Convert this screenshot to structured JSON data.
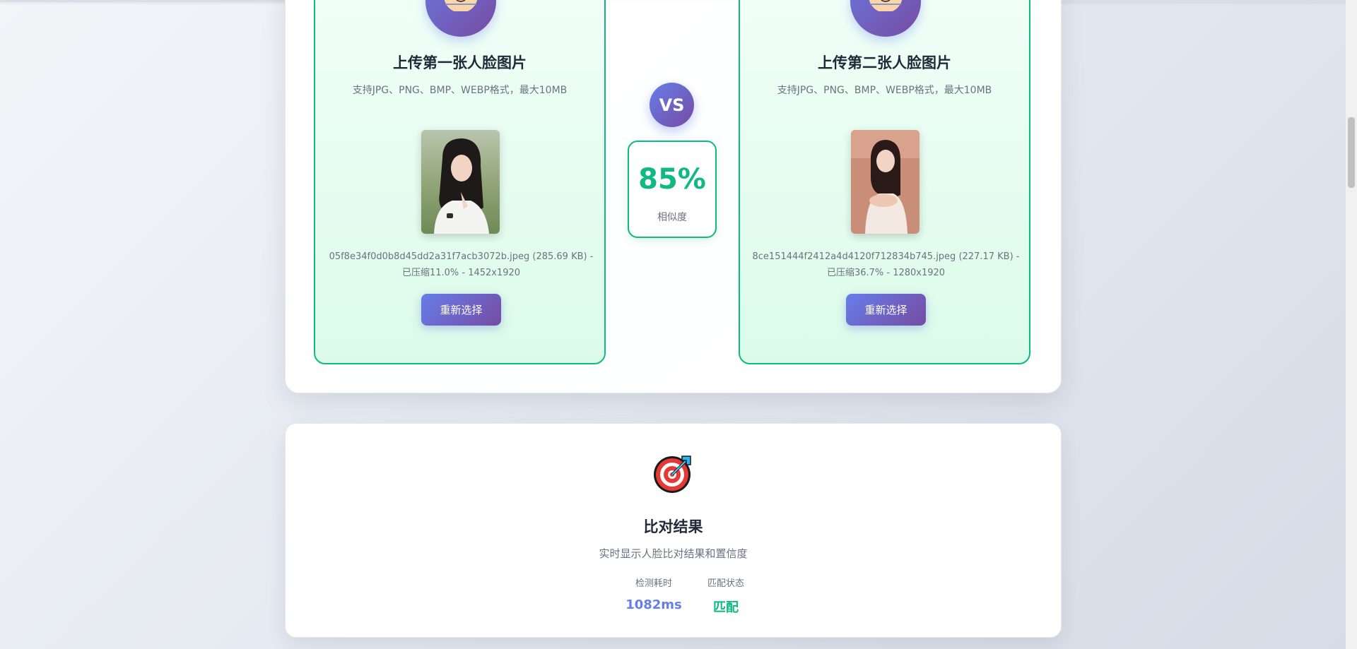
{
  "colors": {
    "accent": "#667eea",
    "accent_dark": "#764ba2",
    "success": "#10b981",
    "text_muted": "#6b7280"
  },
  "compare": {
    "left": {
      "title": "上传第一张人脸图片",
      "subtitle": "支持JPG、PNG、BMP、WEBP格式，最大10MB",
      "file_line1": "05f8e34f0d0b8d45dd2a31f7acb3072b.jpeg (285.69 KB) -",
      "file_line2": "已压缩11.0% - 1452x1920",
      "button": "重新选择"
    },
    "right": {
      "title": "上传第二张人脸图片",
      "subtitle": "支持JPG、PNG、BMP、WEBP格式，最大10MB",
      "file_line1": "8ce151444f2412a4d4120f712834b745.jpeg (227.17 KB) -",
      "file_line2": "已压缩36.7% - 1280x1920",
      "button": "重新选择"
    },
    "vs_label": "VS",
    "similarity": {
      "value": "85%",
      "label": "相似度"
    }
  },
  "result": {
    "icon": "target-icon",
    "title": "比对结果",
    "subtitle": "实时显示人脸比对结果和置信度",
    "stats": [
      {
        "label": "检测耗时",
        "value": "1082ms"
      },
      {
        "label": "匹配状态",
        "value": "匹配"
      }
    ]
  }
}
